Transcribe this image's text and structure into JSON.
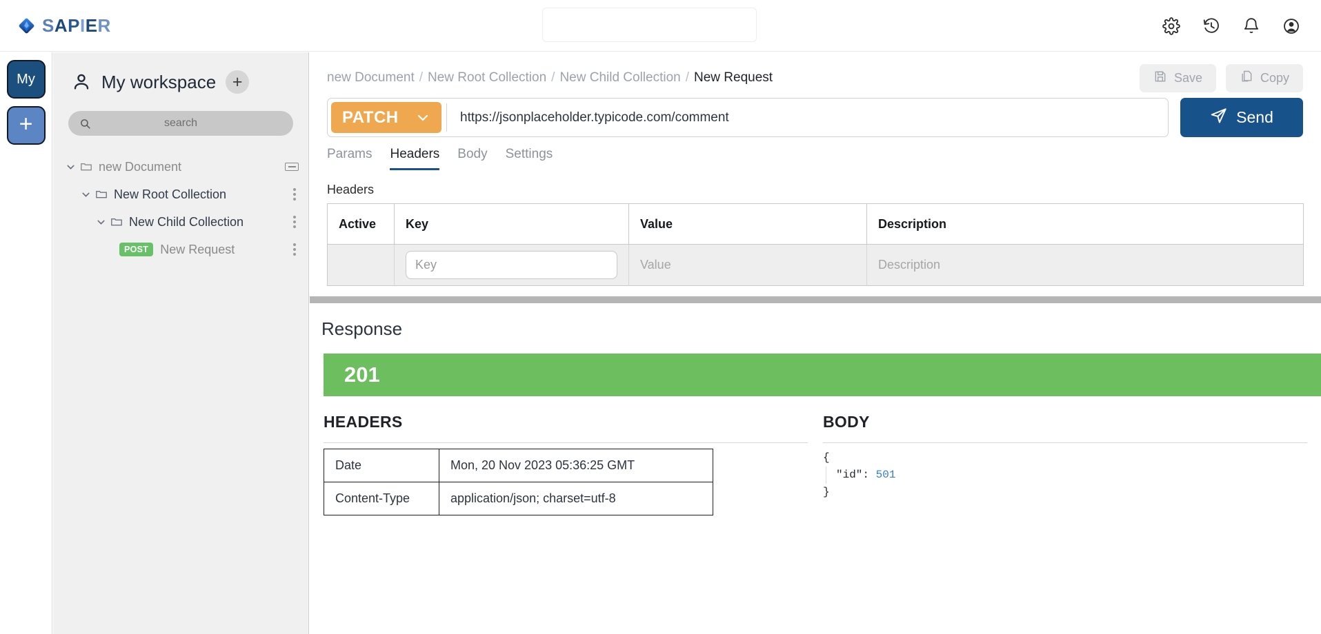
{
  "app": {
    "brand_letters": [
      "S",
      "A",
      "P",
      "I",
      "E",
      "R"
    ],
    "brand_name": "SAPIER"
  },
  "topbar": {
    "search_value": "",
    "search_placeholder": "",
    "icons": [
      "gear-icon",
      "history-icon",
      "bell-icon",
      "account-icon"
    ]
  },
  "rail": {
    "workspace_button": "My",
    "add_button": "+"
  },
  "sidebar": {
    "workspace_title": "My workspace",
    "add_label": "+",
    "search_placeholder": "search",
    "search_value": "",
    "tree": [
      {
        "label": "new Document",
        "level": 0,
        "expanded": true,
        "kind": "folder",
        "menu": "doc"
      },
      {
        "label": "New Root Collection",
        "level": 1,
        "expanded": true,
        "kind": "folder",
        "menu": "kebab"
      },
      {
        "label": "New Child Collection",
        "level": 2,
        "expanded": true,
        "kind": "folder",
        "menu": "kebab"
      },
      {
        "label": "New Request",
        "level": 3,
        "expanded": false,
        "kind": "request",
        "method": "POST",
        "menu": "kebab"
      }
    ]
  },
  "breadcrumb": {
    "segments": [
      "new Document",
      "New Root Collection",
      "New Child Collection"
    ],
    "current": "New Request",
    "separator": "/"
  },
  "actions": {
    "save_label": "Save",
    "copy_label": "Copy"
  },
  "request": {
    "method": "PATCH",
    "url": "https://jsonplaceholder.typicode.com/comment",
    "url_placeholder": "",
    "send_label": "Send",
    "tabs": [
      {
        "label": "Params",
        "active": false
      },
      {
        "label": "Headers",
        "active": true
      },
      {
        "label": "Body",
        "active": false
      },
      {
        "label": "Settings",
        "active": false
      }
    ],
    "headers_section_label": "Headers",
    "headers_columns": [
      "Active",
      "Key",
      "Value",
      "Description"
    ],
    "headers_row": {
      "key_value": "",
      "key_placeholder": "Key",
      "value_placeholder": "Value",
      "description_placeholder": "Description"
    }
  },
  "response": {
    "title": "Response",
    "status_code": "201",
    "status_color": "#6cbe5f",
    "headers_title": "HEADERS",
    "body_title": "BODY",
    "headers_rows": [
      {
        "name": "Date",
        "value": "Mon, 20 Nov 2023 05:36:25 GMT"
      },
      {
        "name": "Content-Type",
        "value": "application/json; charset=utf-8"
      }
    ],
    "body_open": "{",
    "body_line_key": "\"id\":",
    "body_line_value": "501",
    "body_close": "}"
  },
  "colors": {
    "brand_dark": "#1d4a77",
    "brand_light": "#5b80b8",
    "method_patch": "#efa750",
    "send": "#18528a",
    "status_success": "#6cbe5f",
    "post_badge": "#68c168"
  }
}
